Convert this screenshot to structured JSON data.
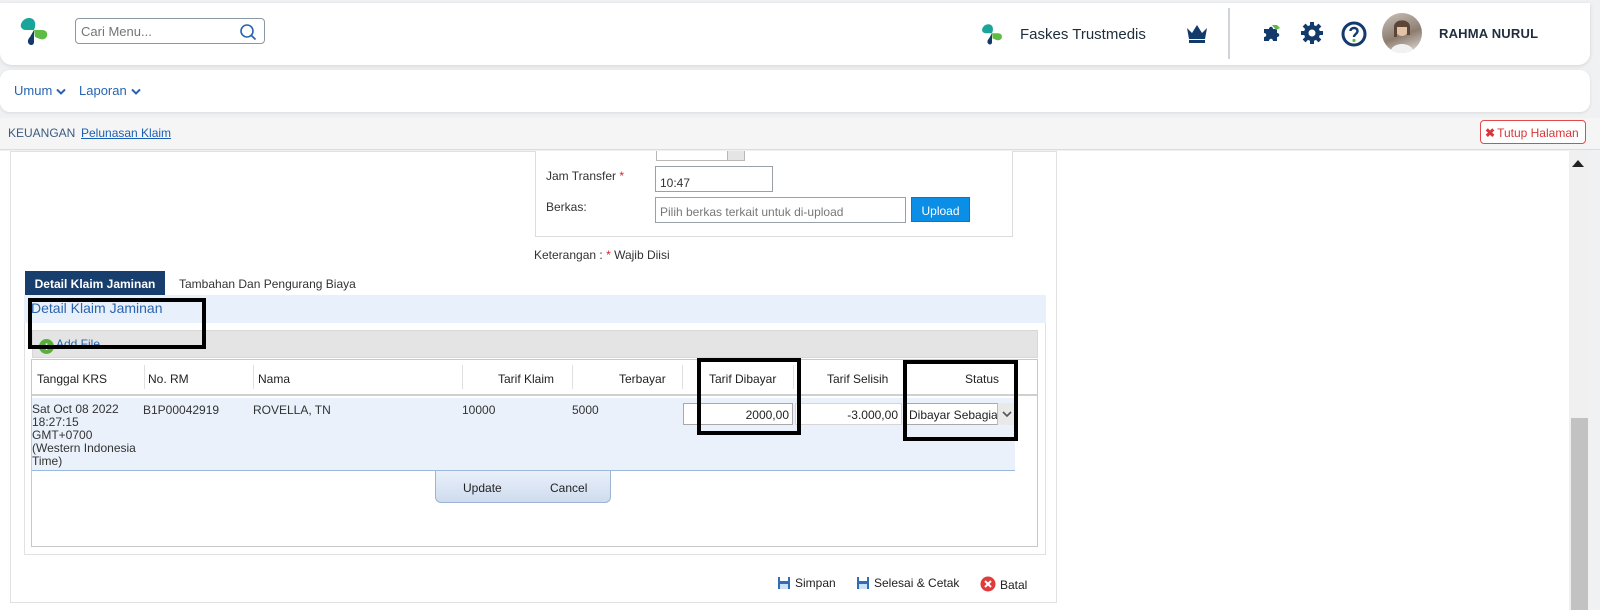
{
  "header": {
    "search_placeholder": "Cari Menu...",
    "facility_name": "Faskes Trustmedis",
    "user_name": "RAHMA NURUL",
    "colors": {
      "brand_teal": "#1aa59a",
      "brand_green": "#5dbb46",
      "navy": "#123a6b"
    },
    "icons": [
      "trustmedis-logo",
      "search-icon",
      "crown-icon",
      "puzzle-icon",
      "gear-icon",
      "help-icon"
    ]
  },
  "menu": {
    "items": [
      {
        "label": "Umum"
      },
      {
        "label": "Laporan"
      }
    ]
  },
  "breadcrumb": {
    "section": "KEUANGAN",
    "page": "Pelunasan Klaim",
    "close_label": "Tutup Halaman"
  },
  "form": {
    "jam_transfer_label": "Jam Transfer",
    "required_mark": "*",
    "jam_transfer_value": "10:47",
    "berkas_label": "Berkas:",
    "berkas_placeholder": "Pilih berkas terkait untuk di-upload",
    "upload_label": "Upload",
    "keterangan_label": "Keterangan :",
    "keterangan_text": "Wajib Diisi"
  },
  "tabs": [
    {
      "label": "Detail Klaim Jaminan",
      "active": true
    },
    {
      "label": "Tambahan Dan Pengurang Biaya",
      "active": false
    }
  ],
  "grid": {
    "title": "Detail Klaim Jaminan",
    "add_file_label": "Add File",
    "columns": [
      "Tanggal KRS",
      "No. RM",
      "Nama",
      "Tarif Klaim",
      "Terbayar",
      "Tarif Dibayar",
      "Tarif Selisih",
      "Status"
    ],
    "rows": [
      {
        "tanggal_krs": "Sat Oct 08 2022 18:27:15 GMT+0700 (Western Indonesia Time)",
        "no_rm": "B1P00042919",
        "nama": "ROVELLA, TN",
        "tarif_klaim": "10000",
        "terbayar": "5000",
        "tarif_dibayar": "2000,00",
        "tarif_selisih": "-3.000,00",
        "status": "Dibayar Sebagian"
      }
    ],
    "row_editor": {
      "update_label": "Update",
      "cancel_label": "Cancel"
    }
  },
  "footer": {
    "simpan_label": "Simpan",
    "selesai_label": "Selesai & Cetak",
    "batal_label": "Batal"
  }
}
